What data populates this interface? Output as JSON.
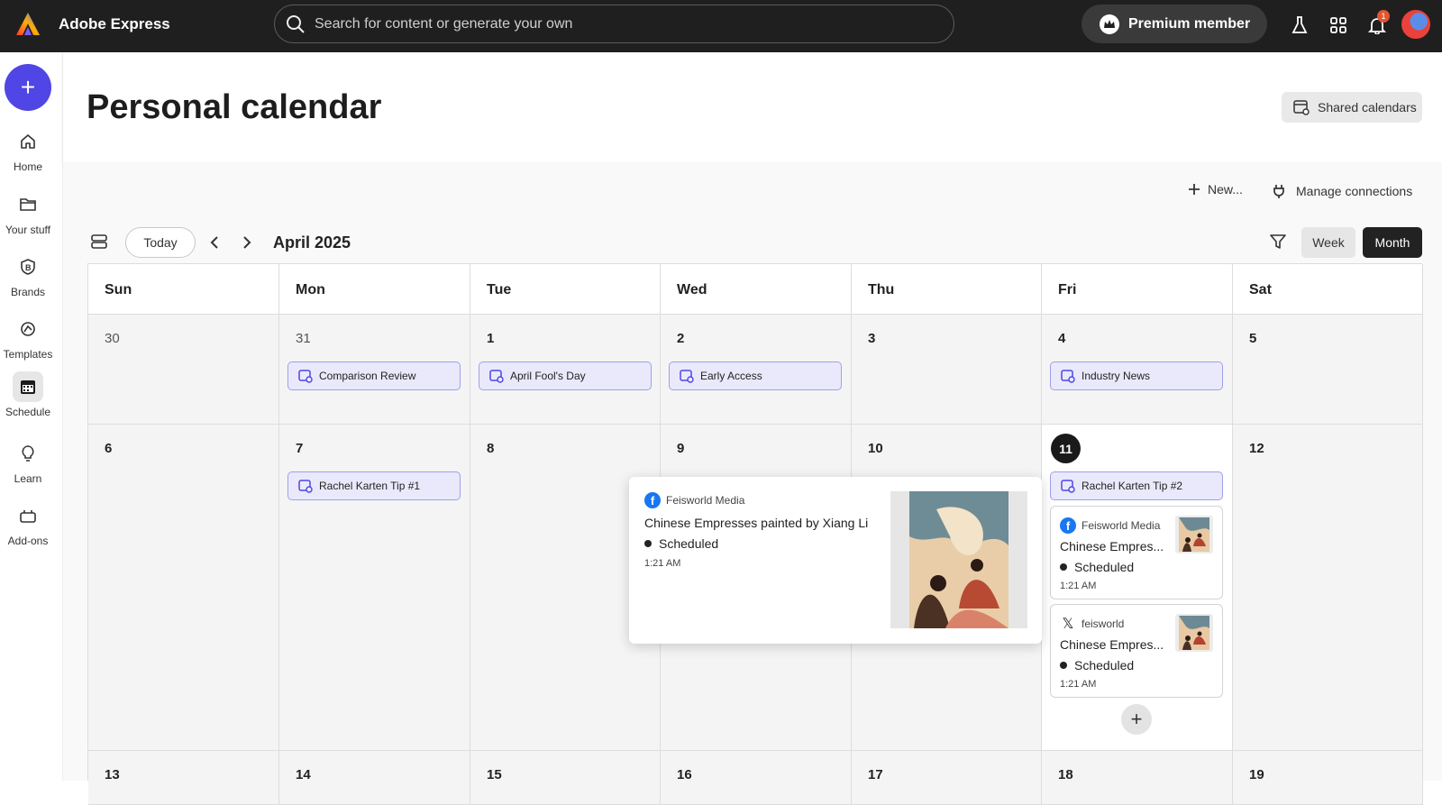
{
  "app": {
    "title": "Adobe Express"
  },
  "search": {
    "placeholder": "Search for content or generate your own"
  },
  "topbar": {
    "premium_label": "Premium member",
    "notification_count": "1"
  },
  "sidebar": {
    "items": [
      {
        "label": "Home",
        "icon": "home-icon"
      },
      {
        "label": "Your stuff",
        "icon": "folder-icon"
      },
      {
        "label": "Brands",
        "icon": "brand-icon"
      },
      {
        "label": "Templates",
        "icon": "templates-icon"
      },
      {
        "label": "Schedule",
        "icon": "calendar-icon",
        "active": true
      },
      {
        "label": "Learn",
        "icon": "lightbulb-icon"
      },
      {
        "label": "Add-ons",
        "icon": "addons-icon"
      }
    ]
  },
  "header": {
    "title": "Personal calendar",
    "shared_calendars": "Shared calendars"
  },
  "actions": {
    "new_label": "New...",
    "manage_label": "Manage connections"
  },
  "toolbar": {
    "today": "Today",
    "month_label": "April 2025",
    "week": "Week",
    "month": "Month"
  },
  "calendar": {
    "day_names": [
      "Sun",
      "Mon",
      "Tue",
      "Wed",
      "Thu",
      "Fri",
      "Sat"
    ],
    "week1": [
      "30",
      "31",
      "1",
      "2",
      "3",
      "4",
      "5"
    ],
    "week2": [
      "6",
      "7",
      "8",
      "9",
      "10",
      "11",
      "12"
    ],
    "week3": [
      "13",
      "14",
      "15",
      "16",
      "17",
      "18",
      "19"
    ],
    "events": {
      "mon31": "Comparison Review",
      "tue1": "April Fool's Day",
      "wed2": "Early Access",
      "fri4": "Industry News",
      "mon7": "Rachel Karten Tip #1",
      "fri11": "Rachel Karten Tip #2"
    },
    "posts": [
      {
        "source": "Feisworld Media",
        "network": "facebook",
        "title": "Chinese Empres...",
        "status": "Scheduled",
        "time": "1:21 AM"
      },
      {
        "source": "feisworld",
        "network": "x",
        "title": "Chinese Empres...",
        "status": "Scheduled",
        "time": "1:21 AM"
      }
    ]
  },
  "popover": {
    "source": "Feisworld Media",
    "title": "Chinese Empresses painted by Xiang Li",
    "status": "Scheduled",
    "time": "1:21 AM"
  },
  "colors": {
    "accent": "#4f46e5",
    "event_bg": "#e9e9fb",
    "event_border": "#9fa0ea",
    "facebook": "#1877f2"
  }
}
